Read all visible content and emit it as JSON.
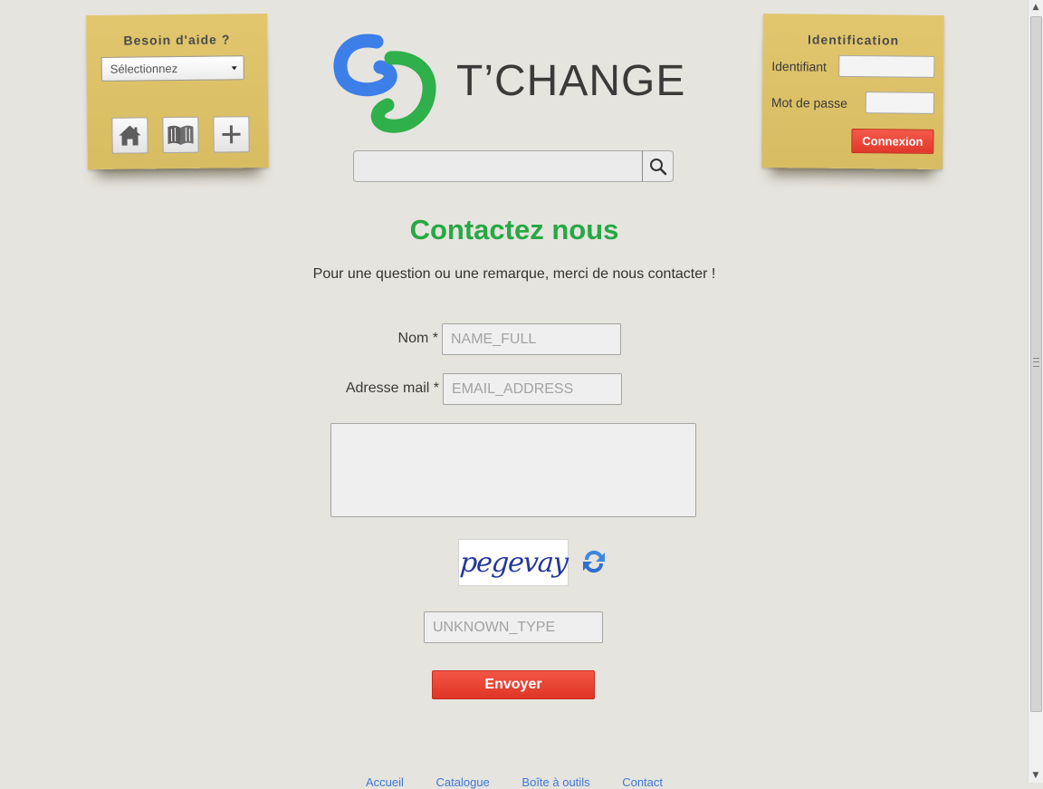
{
  "help_note": {
    "title": "Besoin d'aide ?",
    "select_value": "Sélectionnez",
    "buttons": [
      {
        "icon": "home-icon"
      },
      {
        "icon": "book-icon"
      },
      {
        "icon": "plus-icon"
      }
    ]
  },
  "login_note": {
    "title": "Identification",
    "username_label": "Identifiant",
    "password_label": "Mot de passe",
    "submit_label": "Connexion",
    "submit_color": "#e8473a"
  },
  "logo": {
    "text": "T’CHANGE",
    "colors": {
      "blue": "#3d7fe8",
      "green": "#2fb04a"
    }
  },
  "search": {
    "value": "",
    "icon": "search-icon"
  },
  "contact": {
    "title": "Contactez nous",
    "title_color": "#27a845",
    "subtitle": "Pour une question ou une remarque, merci de nous contacter !",
    "name_label": "Nom *",
    "name_placeholder": "NAME_FULL",
    "email_label": "Adresse mail *",
    "email_placeholder": "EMAIL_ADDRESS",
    "message_value": "",
    "captcha_text": "pegevay",
    "captcha_refresh_icon": "refresh-icon",
    "captcha_placeholder": "UNKNOWN_TYPE",
    "submit_label": "Envoyer",
    "submit_color": "#e84232"
  },
  "footer": {
    "links": [
      "Accueil",
      "Catalogue",
      "Boîte à outils",
      "Contact"
    ]
  }
}
